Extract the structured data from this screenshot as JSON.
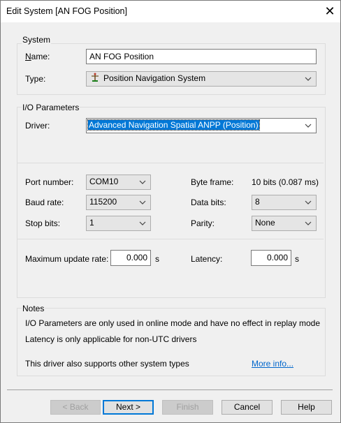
{
  "window": {
    "title": "Edit System [AN FOG Position]"
  },
  "system": {
    "legend": "System",
    "name_label": "Name:",
    "name_value": "AN FOG Position",
    "type_label": "Type:",
    "type_value": "Position Navigation System",
    "type_icon": "position-antenna-icon"
  },
  "io": {
    "legend": "I/O Parameters",
    "driver_label": "Driver:",
    "driver_value": "Advanced Navigation Spatial ANPP (Position)",
    "port_label": "Port number:",
    "port_value": "COM10",
    "baud_label": "Baud rate:",
    "baud_value": "115200",
    "stop_label": "Stop bits:",
    "stop_value": "1",
    "byteframe_label": "Byte frame:",
    "byteframe_value": "10 bits (0.087 ms)",
    "databits_label": "Data bits:",
    "databits_value": "8",
    "parity_label": "Parity:",
    "parity_value": "None",
    "maxrate_label": "Maximum update rate:",
    "maxrate_value": "0.000",
    "maxrate_unit": "s",
    "latency_label": "Latency:",
    "latency_value": "0.000",
    "latency_unit": "s"
  },
  "notes": {
    "legend": "Notes",
    "line1": "I/O Parameters are only used in online mode and have no effect in replay mode",
    "line2": "Latency is only applicable for non-UTC drivers",
    "line3": "This driver also supports other system types",
    "more_link": "More info..."
  },
  "buttons": {
    "back": "< Back",
    "next": "Next >",
    "finish": "Finish",
    "cancel": "Cancel",
    "help": "Help"
  },
  "colors": {
    "accent": "#0078d7",
    "link": "#0066cc",
    "background": "#f0f0f0"
  }
}
